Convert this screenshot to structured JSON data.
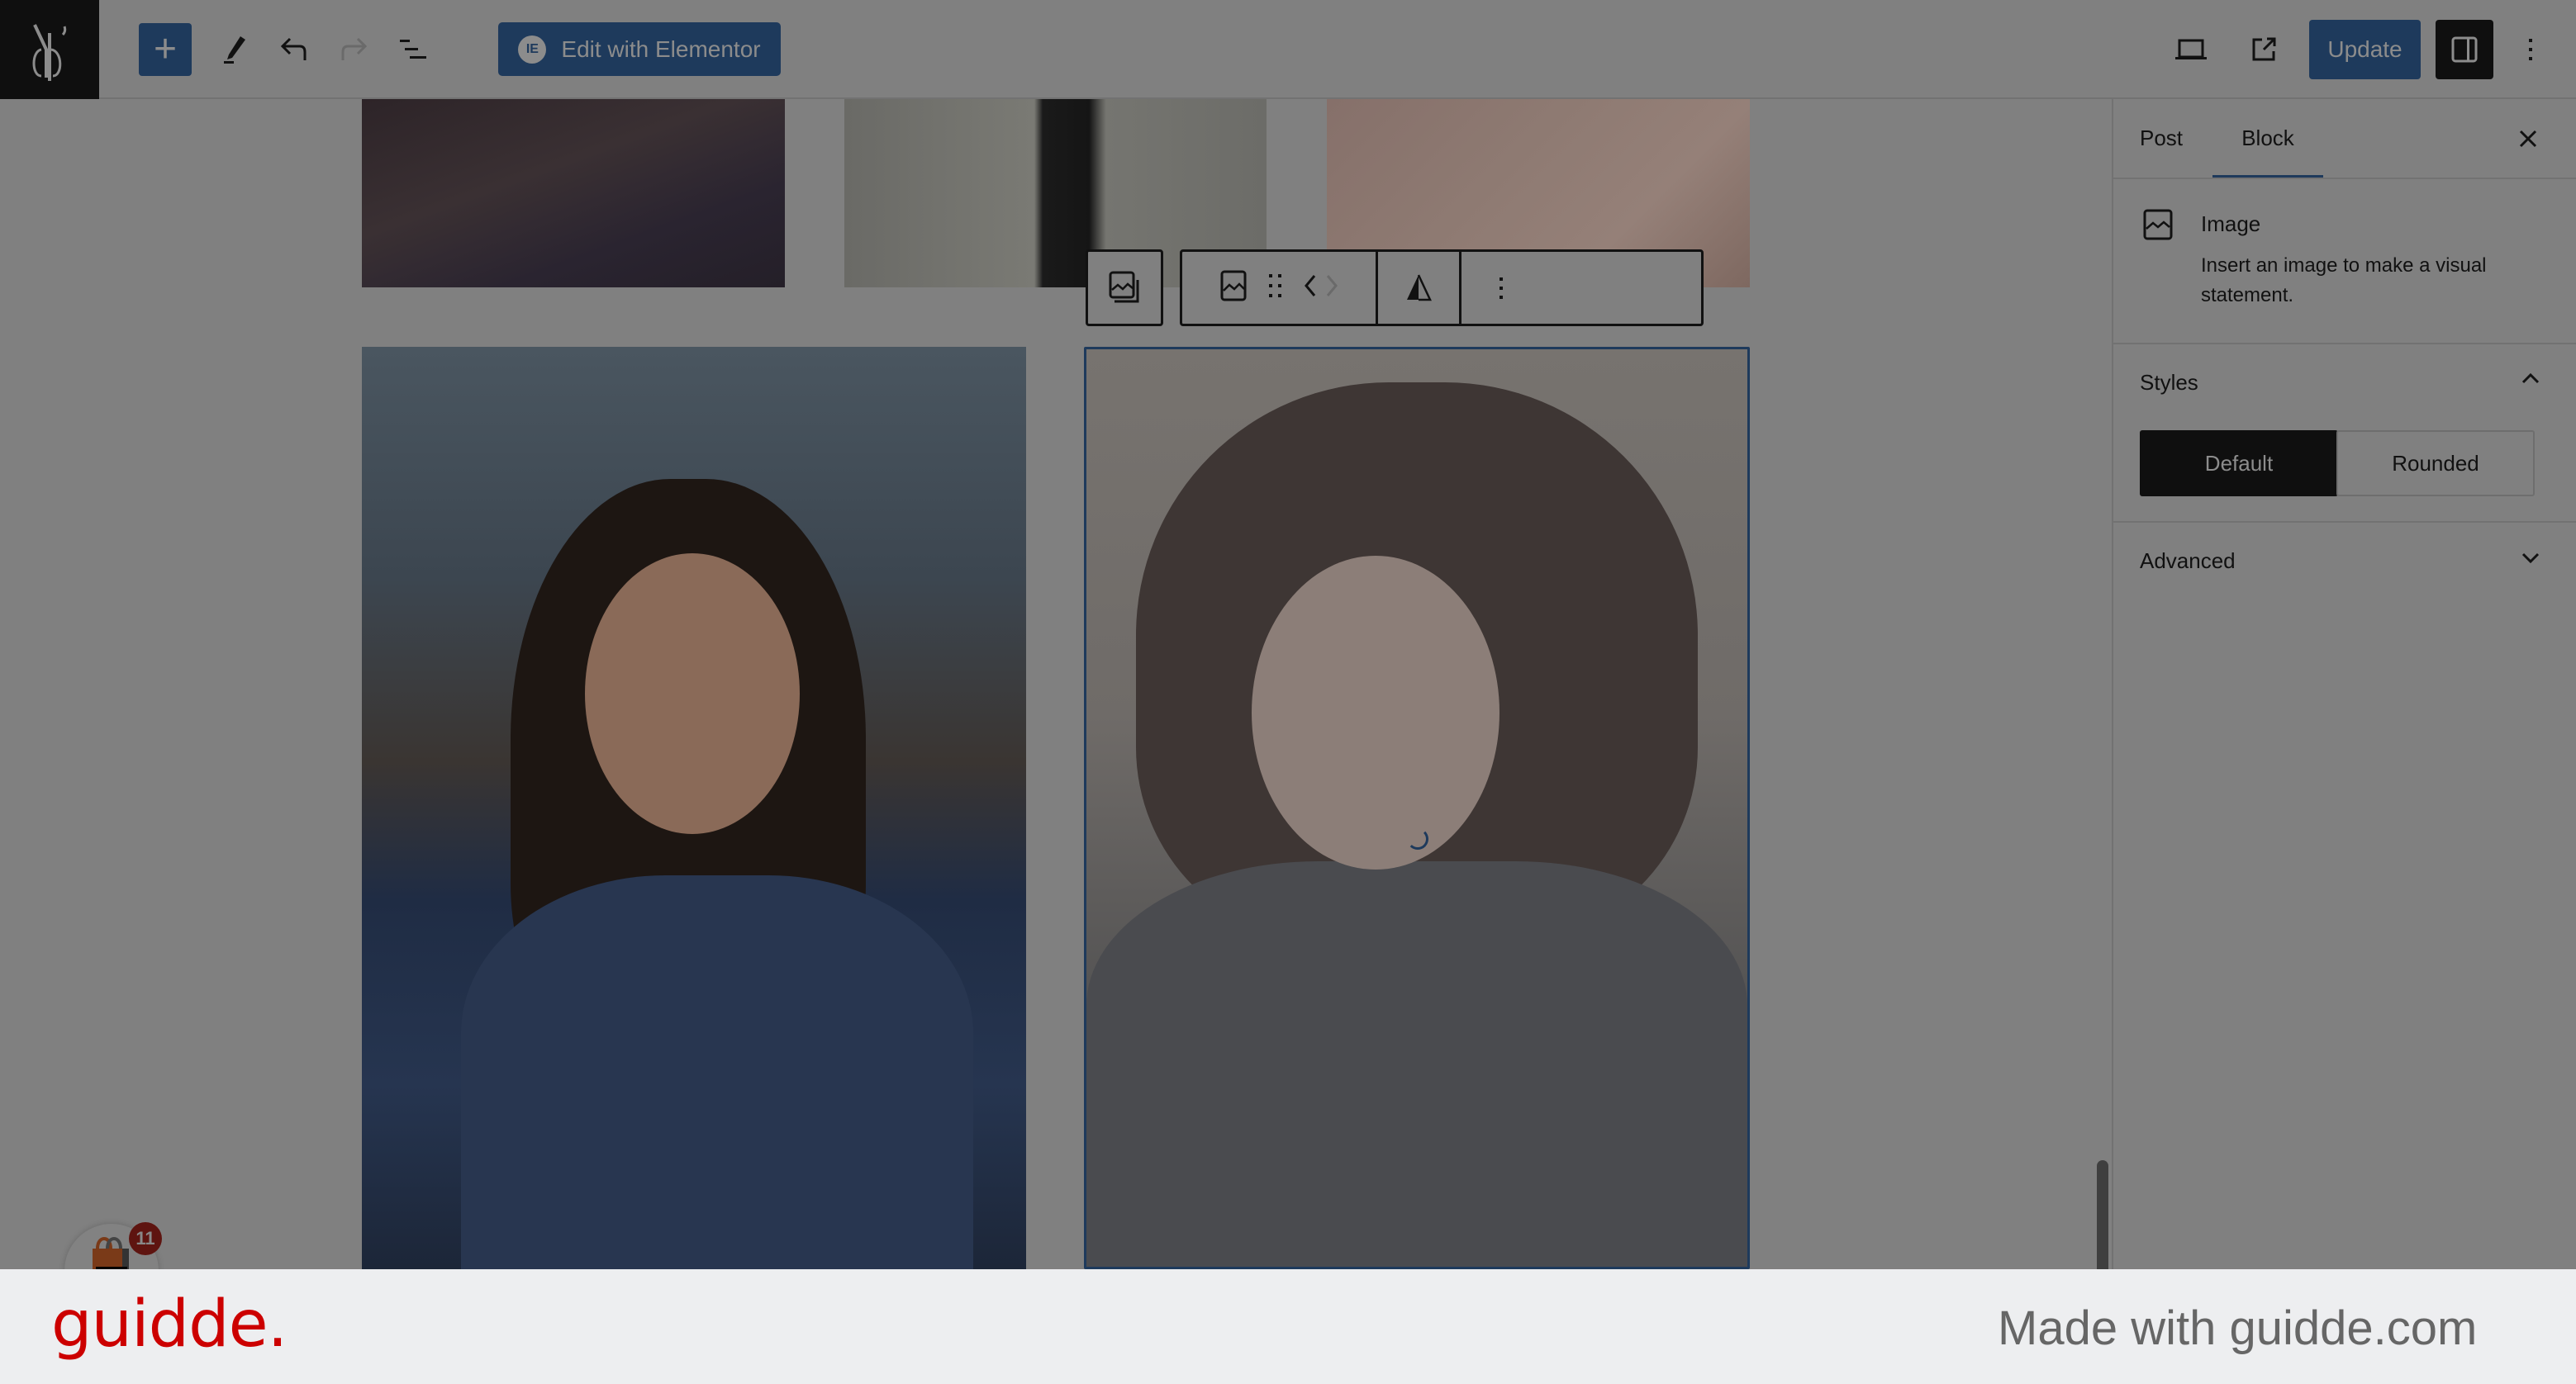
{
  "header": {
    "logo_alt": "Site logo",
    "icons": {
      "add": "plus-icon",
      "tools": "pencil-icon",
      "undo": "undo-icon",
      "redo": "redo-icon",
      "list_view": "list-view-icon",
      "preview": "laptop-icon",
      "view_post": "external-link-icon",
      "settings": "sidebar-toggle-icon",
      "options": "more-vertical-icon"
    },
    "plus_label": "+",
    "elementor_label": "Edit with Elementor",
    "elementor_icon_text": "IE",
    "update_label": "Update"
  },
  "canvas": {
    "gallery_images": [
      {
        "position": "row1-col1",
        "selected": false
      },
      {
        "position": "row1-col2",
        "selected": false
      },
      {
        "position": "row1-col3",
        "selected": false
      },
      {
        "position": "row2-col1",
        "selected": false
      },
      {
        "position": "row2-col2",
        "selected": true,
        "loading": true
      }
    ],
    "block_toolbar": {
      "items": [
        "image-switch",
        "image-block-icon",
        "drag-handle",
        "move-left",
        "move-right",
        "alignment-triangle",
        "more-options"
      ]
    }
  },
  "sidebar": {
    "tabs": [
      {
        "label": "Post",
        "active": false
      },
      {
        "label": "Block",
        "active": true
      }
    ],
    "block": {
      "title": "Image",
      "description": "Insert an image to make a visual statement."
    },
    "styles": {
      "title": "Styles",
      "expanded": true,
      "options": [
        {
          "label": "Default",
          "selected": true
        },
        {
          "label": "Rounded",
          "selected": false
        }
      ]
    },
    "advanced": {
      "title": "Advanced",
      "expanded": false
    }
  },
  "floating_badge": {
    "icon": "shopping-bag-icon",
    "count": "11"
  },
  "footer": {
    "brand": "guidde.",
    "tagline": "Made with guidde.com"
  },
  "colors": {
    "accent": "#1e3a5c",
    "brand_red": "#cc0000",
    "overlay_gray": "#808080"
  }
}
